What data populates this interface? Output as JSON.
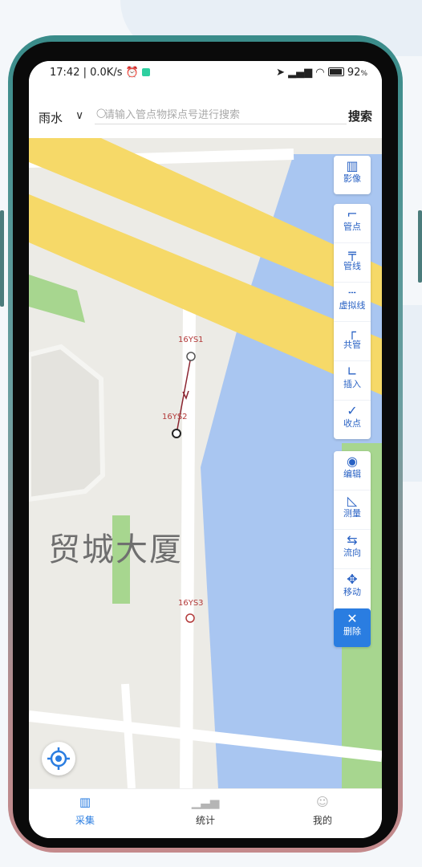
{
  "status": {
    "time": "17:42",
    "speed": "0.0K/s",
    "battery": "92"
  },
  "search": {
    "city": "雨水",
    "placeholder": "请输入管点物探点号进行搜索",
    "button": "搜索"
  },
  "map": {
    "poi_label": "贸城大厦",
    "points": [
      {
        "label": "16YS1"
      },
      {
        "label": "16YS2"
      },
      {
        "label": "16YS3"
      }
    ]
  },
  "toolbar": {
    "imagery": {
      "label": "影像",
      "icon": "map-icon"
    },
    "tools": [
      {
        "label": "管点",
        "icon": "pipe-point-icon"
      },
      {
        "label": "管线",
        "icon": "pipe-line-icon"
      },
      {
        "label": "虚拟线",
        "icon": "virtual-line-icon"
      },
      {
        "label": "共管",
        "icon": "shared-pipe-icon"
      },
      {
        "label": "插入",
        "icon": "insert-icon"
      },
      {
        "label": "收点",
        "icon": "collect-point-icon"
      }
    ],
    "edit_tools": [
      {
        "label": "编辑",
        "icon": "edit-icon"
      },
      {
        "label": "测量",
        "icon": "measure-icon"
      },
      {
        "label": "流向",
        "icon": "flow-direction-icon"
      },
      {
        "label": "移动",
        "icon": "move-icon"
      },
      {
        "label": "删除",
        "icon": "delete-icon"
      }
    ]
  },
  "tabs": [
    {
      "label": "采集",
      "icon": "map-icon",
      "active": true
    },
    {
      "label": "统计",
      "icon": "stats-icon",
      "active": false
    },
    {
      "label": "我的",
      "icon": "user-icon",
      "active": false
    }
  ],
  "colors": {
    "accent": "#2a7de1",
    "road_yellow": "#f6d968",
    "water": "#a9c6f1",
    "park": "#a7d68f",
    "pipe_line": "#8b2430"
  }
}
